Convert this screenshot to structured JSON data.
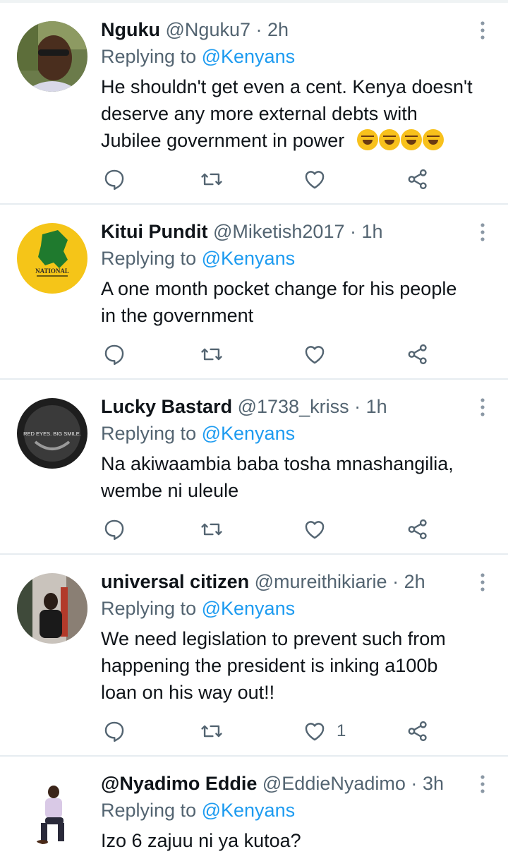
{
  "tweets": [
    {
      "name": "Nguku",
      "handle": "@Nguku7",
      "time": "2h",
      "replying_prefix": "Replying to",
      "replying_to": "@Kenyans",
      "text_lines": [
        "He shouldn't get even a cent. Kenya doesn't",
        "deserve any more external debts with",
        "Jubilee government in power"
      ],
      "emoji_count": 4,
      "like_count": ""
    },
    {
      "name": "Kitui Pundit",
      "handle": "@Miketish2017",
      "time": "1h",
      "replying_prefix": "Replying to",
      "replying_to": "@Kenyans",
      "text_lines": [
        "A one month pocket change for his people",
        "in the government"
      ],
      "avatar_text": "NATIONAL",
      "like_count": ""
    },
    {
      "name": "Lucky Bastard",
      "handle": "@1738_kriss",
      "time": "1h",
      "replying_prefix": "Replying to",
      "replying_to": "@Kenyans",
      "text_lines": [
        "Na akiwaambia baba tosha mnashangilia,",
        "wembe ni uleule"
      ],
      "avatar_text": "RED EYES. BIG SMILE.",
      "like_count": ""
    },
    {
      "name": "universal citizen",
      "handle": "@mureithikiarie",
      "time": "2h",
      "replying_prefix": "Replying to",
      "replying_to": "@Kenyans",
      "text_lines": [
        "We need legislation to prevent such from",
        "happening the president is inking a100b",
        "loan on his way out!!"
      ],
      "like_count": "1"
    },
    {
      "name": "@Nyadimo Eddie",
      "handle": "@EddieNyadimo",
      "time": "3h",
      "replying_prefix": "Replying to",
      "replying_to": "@Kenyans",
      "text_lines": [
        "Izo 6 zajuu ni ya kutoa?"
      ],
      "like_count": ""
    }
  ],
  "icons": {
    "reply": "reply-icon",
    "retweet": "retweet-icon",
    "like": "heart-icon",
    "share": "share-icon",
    "more": "more-vertical-icon"
  },
  "colors": {
    "link": "#1d9bf0",
    "secondary_text": "#536471",
    "divider": "#e6ecf0"
  }
}
